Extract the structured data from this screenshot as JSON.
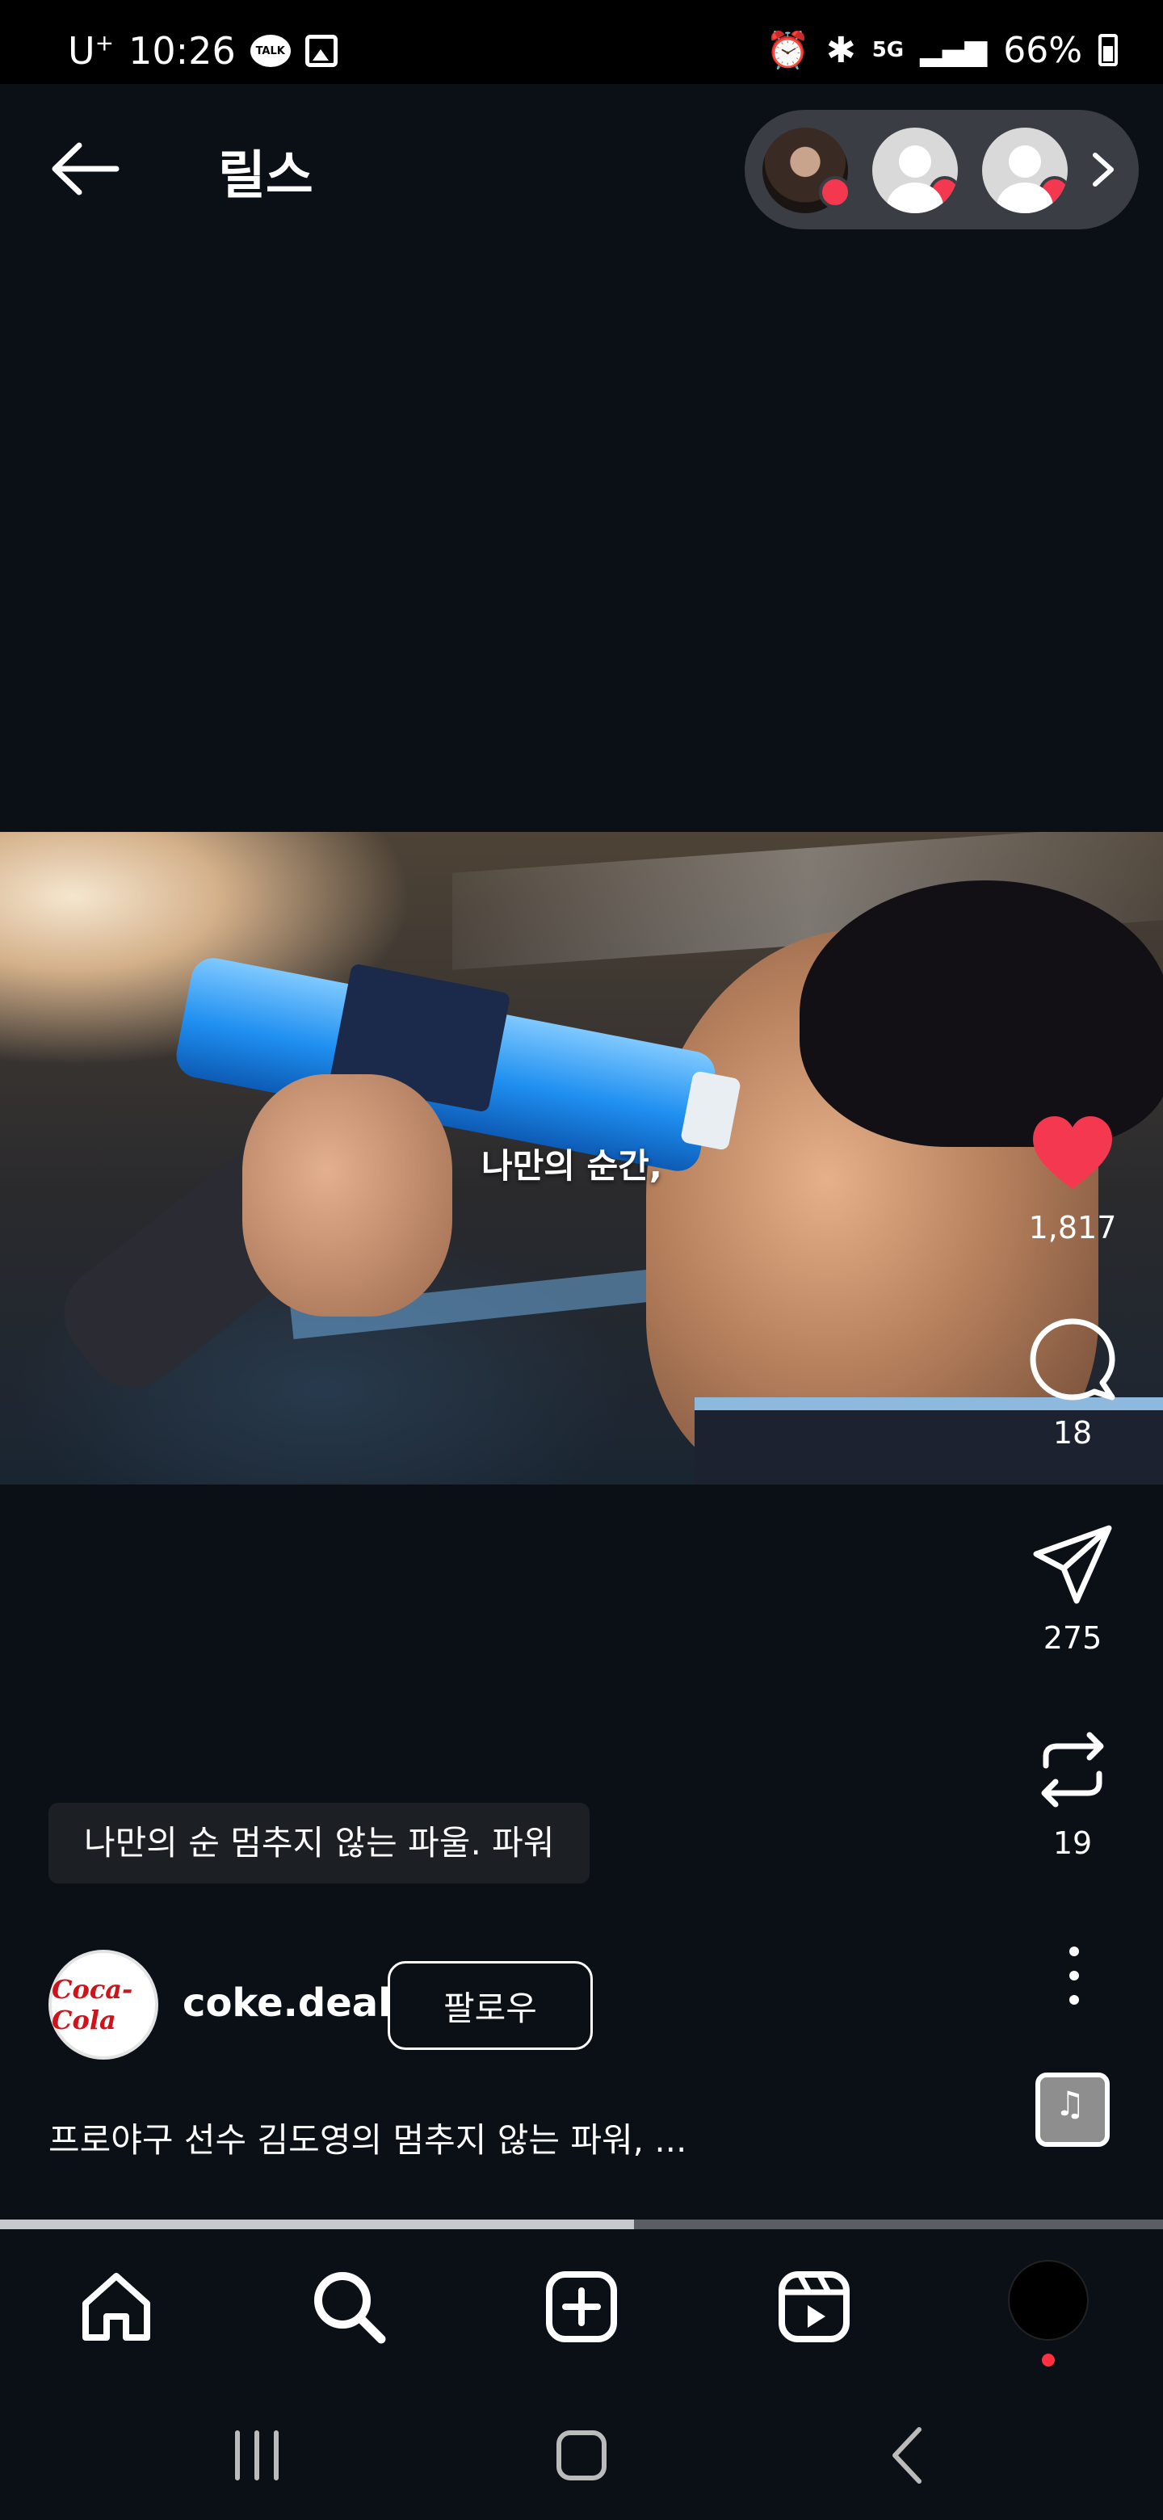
{
  "status_bar": {
    "carrier": "U",
    "carrier_sup": "+",
    "time": "10:26",
    "talk_label": "TALK",
    "network": "5G",
    "battery": "66%"
  },
  "header": {
    "title": "릴스"
  },
  "video": {
    "caption": "나만의 순간,"
  },
  "actions": {
    "likes": "1,817",
    "comments": "18",
    "shares": "275",
    "reposts": "19"
  },
  "caption_chip": "나만의 순 멈추지 않는 파울. 파워",
  "author": {
    "logo_text": "Coca-Cola",
    "username": "coke.deal",
    "follow_label": "팔로우"
  },
  "description": "프로야구 선수 김도영의 멈추지 않는 파워, ...",
  "progress": 0.545,
  "colors": {
    "background": "#0b0f16",
    "like_red": "#f3384f",
    "accent_dot": "#ff3040"
  },
  "icons": {
    "back": "arrow-left-icon",
    "like": "heart-icon",
    "comment": "comment-icon",
    "share": "send-icon",
    "repost": "repost-icon",
    "more": "more-vertical-icon",
    "home": "home-icon",
    "search": "search-icon",
    "create": "plus-square-icon",
    "reels": "reels-icon"
  }
}
